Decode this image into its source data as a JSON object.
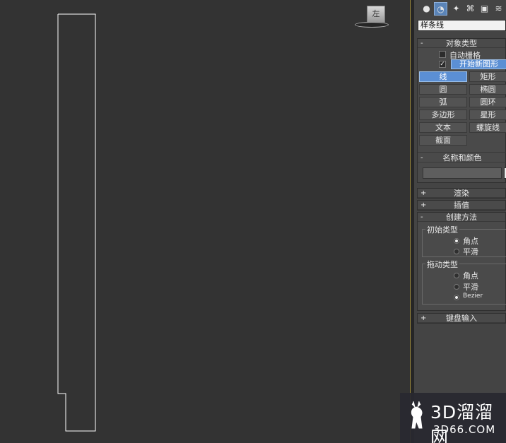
{
  "viewport": {
    "viewcube_label": "左",
    "shape_color": "#ffffff",
    "background": "#333333"
  },
  "command_panel": {
    "tabs": [
      {
        "icon": "geometry-icon"
      },
      {
        "icon": "shapes-icon",
        "active": true
      },
      {
        "icon": "lights-icon"
      },
      {
        "icon": "cameras-icon"
      },
      {
        "icon": "helpers-icon"
      },
      {
        "icon": "space-warps-icon"
      }
    ],
    "category_dropdown": "样条线",
    "object_type": {
      "title": "对象类型",
      "auto_grid_label": "自动栅格",
      "auto_grid_checked": false,
      "start_new_shape_checked": true,
      "start_new_shape_label": "开始新图形",
      "buttons": [
        "线",
        "矩形",
        "圆",
        "椭圆",
        "弧",
        "圆环",
        "多边形",
        "星形",
        "文本",
        "螺旋线",
        "截面"
      ],
      "active_button": "线"
    },
    "name_color": {
      "title": "名称和颜色",
      "name_value": ""
    },
    "rollouts_collapsed": [
      "渲染",
      "插值"
    ],
    "creation_method": {
      "title": "创建方法",
      "initial_type": {
        "title": "初始类型",
        "options": [
          "角点",
          "平滑"
        ],
        "selected": "角点"
      },
      "drag_type": {
        "title": "拖动类型",
        "options": [
          "角点",
          "平滑",
          "Bezier"
        ],
        "selected": "Bezier"
      }
    },
    "keyboard_entry_title": "键盘输入",
    "expand_sign": "+",
    "collapse_sign": "-"
  },
  "watermark": {
    "line1": "3D溜溜网",
    "line2": "3D66.COM"
  },
  "accent_color": "#5b8fd4"
}
